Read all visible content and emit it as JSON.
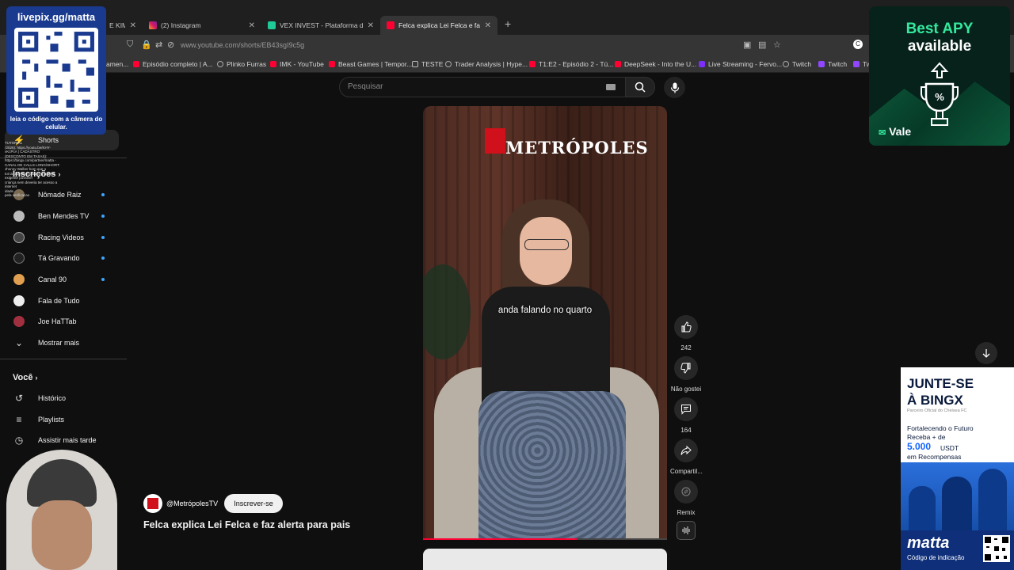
{
  "browser": {
    "tabs": [
      {
        "label": "E KIM K",
        "active": false
      },
      {
        "label": "(2) Instagram",
        "active": false
      },
      {
        "label": "VEX INVEST - Plataforma de Inv",
        "active": false
      },
      {
        "label": "Felca explica Lei Felca e faz",
        "active": true
      }
    ],
    "url": "www.youtube.com/shorts/EB43sgI9c5g",
    "bookmarks": [
      "amen...",
      "Episódio completo | A...",
      "Plinko Furras",
      "IMK - YouTube",
      "Beast Games | Tempor...",
      "TESTE",
      "Trader Analysis | Hype...",
      "T1:E2 - Episódio 2 - Tú...",
      "DeepSeek - Into the U...",
      "Live Streaming - Fervo...",
      "Twitch",
      "Twitch",
      "Tw"
    ]
  },
  "sidebar": {
    "shorts": "Shorts",
    "subscriptions_title": "Inscrições",
    "channels": [
      {
        "name": "Nômade Raiz",
        "new": true
      },
      {
        "name": "Ben Mendes TV",
        "new": true
      },
      {
        "name": "Racing Videos",
        "new": true
      },
      {
        "name": "Tá Gravando",
        "new": true
      },
      {
        "name": "Canal 90",
        "new": true
      },
      {
        "name": "Fala de Tudo",
        "new": false
      },
      {
        "name": "Joe HaTTab",
        "new": false
      }
    ],
    "show_more": "Mostrar mais",
    "you_title": "Você",
    "you_items": [
      "Histórico",
      "Playlists",
      "Assistir mais tarde"
    ]
  },
  "search": {
    "placeholder": "Pesquisar"
  },
  "video": {
    "brand": "METRÓPOLES",
    "caption": "anda falando no quarto",
    "progress": 0.63
  },
  "actions": {
    "likes": "242",
    "dislike": "Não gostei",
    "comments": "164",
    "share": "Compartil...",
    "remix": "Remix"
  },
  "channel": {
    "handle": "@MetrópolesTV",
    "subscribe": "Inscrever-se",
    "title": "Felca explica Lei Felca e faz alerta para pais"
  },
  "overlays": {
    "qr": {
      "site": "livepix.gg/matta",
      "caption": "leia o código com a câmera do celular."
    },
    "chat": [
      "TUTORIAL",
      "(2026): https://youtu.be/KHY-",
      "vKcPcA | CADASTRO",
      "(DESCONTO EM TAXAS):",
      "https://bingx.com/partner/matta -",
      "CANAL DE CALLS LONG/SHORT:",
      "Jhonny Walker bom que o",
      "tot ta usando a plataforma mais",
      "exigente possível",
      "criança nem deveria ter acesso a",
      "internet",
      "idade",
      "pela verificacao"
    ],
    "apy": {
      "line1": "Best APY",
      "line2": "available",
      "brand": "Vale"
    },
    "bingx": {
      "headline1": "JUNTE-SE",
      "headline2": "À BINGX",
      "partner": "Parceiro Oficial do Chelsea FC",
      "line1": "Fortalecendo o Futuro",
      "line2": "Receba + de",
      "amount": "5.000",
      "unit": "USDT",
      "line3": "em Recompensas",
      "handle": "matta",
      "code_label": "Código de indicação"
    }
  },
  "colors": {
    "yt_red": "#ff0033",
    "subscribe_bg": "#f1f1f1",
    "apy_green": "#34e89e",
    "bingx_blue": "#1565ff"
  }
}
